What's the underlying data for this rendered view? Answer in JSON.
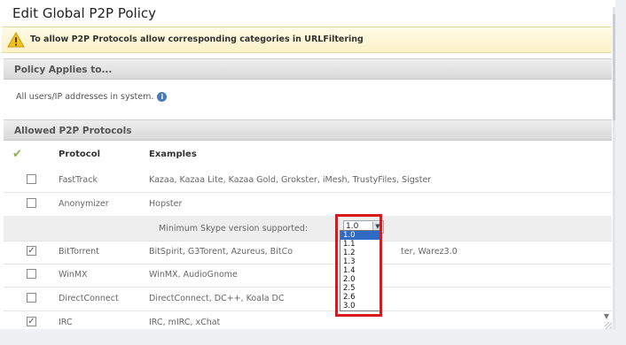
{
  "dialog": {
    "title": "Edit Global P2P Policy",
    "warning": "To allow P2P Protocols allow corresponding categories in URLFiltering"
  },
  "policy": {
    "heading": "Policy Applies to...",
    "applies_text": "All users/IP addresses in system."
  },
  "allowed": {
    "heading": "Allowed P2P Protocols",
    "col_protocol": "Protocol",
    "col_examples": "Examples",
    "skype_label": "Minimum Skype version supported:",
    "skype_selected": "1.0",
    "skype_options": [
      "1.0",
      "1.1",
      "1.2",
      "1.3",
      "1.4",
      "2.0",
      "2.5",
      "2.6",
      "3.0"
    ],
    "rows": [
      {
        "protocol": "FastTrack",
        "examples": "Kazaa, Kazaa Lite, Kazaa Gold, Grokster, iMesh, TrustyFiles, Sigster",
        "checked": false
      },
      {
        "protocol": "Anonymizer",
        "examples": "Hopster",
        "checked": false
      },
      {
        "protocol": "BitTorrent",
        "examples": "BitSpirit, G3Torent, Azureus, BitCo",
        "examples_tail": "ter, Warez3.0",
        "checked": true
      },
      {
        "protocol": "WinMX",
        "examples": "WinMX, AudioGnome",
        "checked": false
      },
      {
        "protocol": "DirectConnect",
        "examples": "DirectConnect, DC++, Koala DC",
        "checked": false
      },
      {
        "protocol": "IRC",
        "examples": "IRC, mIRC, xChat",
        "checked": true
      }
    ]
  },
  "colors": {
    "highlight": "#d81a1a",
    "selected_option": "#3169c6",
    "check_icon": "#8ab24a"
  }
}
